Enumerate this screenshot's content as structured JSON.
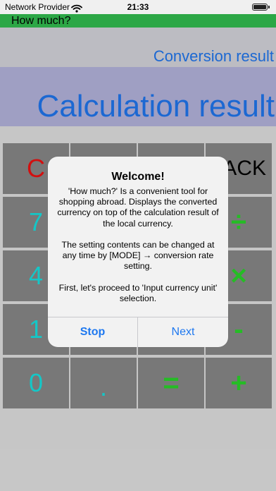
{
  "status_bar": {
    "carrier": "Network Provider",
    "time": "21:33",
    "icons": [
      "wifi-icon",
      "battery-icon"
    ]
  },
  "app": {
    "title": "How much?",
    "conversion_result": "Conversion result",
    "calculation_result": "Calculation result"
  },
  "keypad": {
    "clear": "C",
    "back": "BACK",
    "seven": "7",
    "four": "4",
    "one": "1",
    "zero": "0",
    "dot": ".",
    "equals": "=",
    "divide": "÷",
    "multiply": "×",
    "minus": "-",
    "plus": "+"
  },
  "dialog": {
    "title": "Welcome!",
    "message": [
      "'How much?' Is a convenient tool for shopping abroad. Displays the converted currency on top of the calculation result of the local currency.",
      "The setting contents can be changed at any time by [MODE] → conversion rate setting.",
      "First, let's proceed to 'Input currency unit' selection."
    ],
    "stop_label": "Stop",
    "next_label": "Next"
  },
  "colors": {
    "title_bar": "#2fb24b",
    "result_text": "#1e6fe0",
    "digit_text": "#16d4d4",
    "operator_text": "#28c828",
    "clear_text": "#e01010",
    "dialog_button": "#1e78f0"
  }
}
